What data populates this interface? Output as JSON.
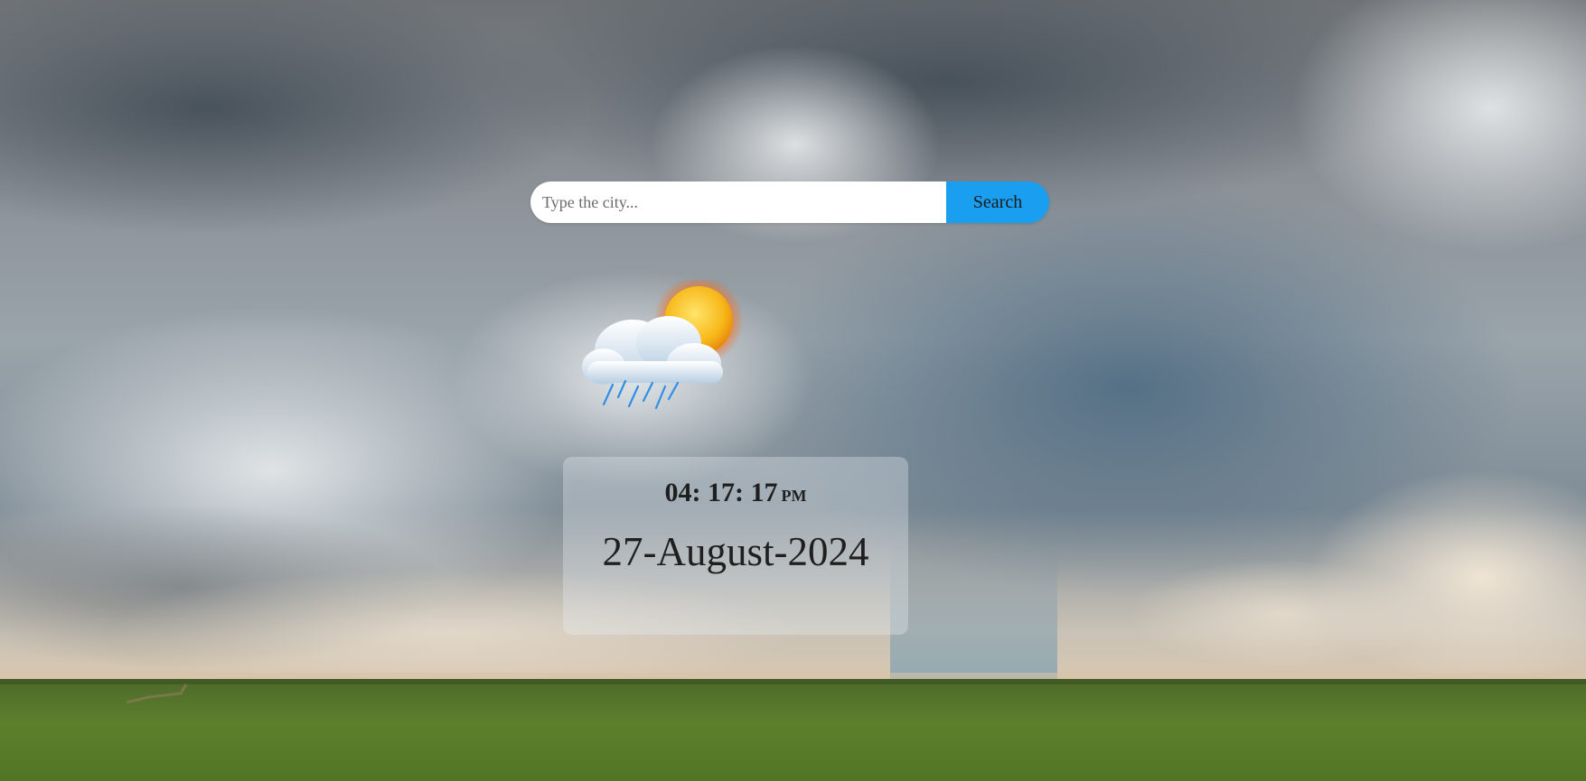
{
  "search": {
    "placeholder": "Type the city...",
    "value": "",
    "button_label": "Search"
  },
  "weather": {
    "icon": "sun-cloud-rain-icon"
  },
  "clock": {
    "hours": "04",
    "minutes": "17",
    "seconds": "17",
    "period": "PM",
    "separator": ": "
  },
  "date": {
    "text": "27-August-2024"
  },
  "colors": {
    "search_button": "#1a9ef0",
    "input_background": "#ffffff",
    "text": "#1f1f1f"
  }
}
